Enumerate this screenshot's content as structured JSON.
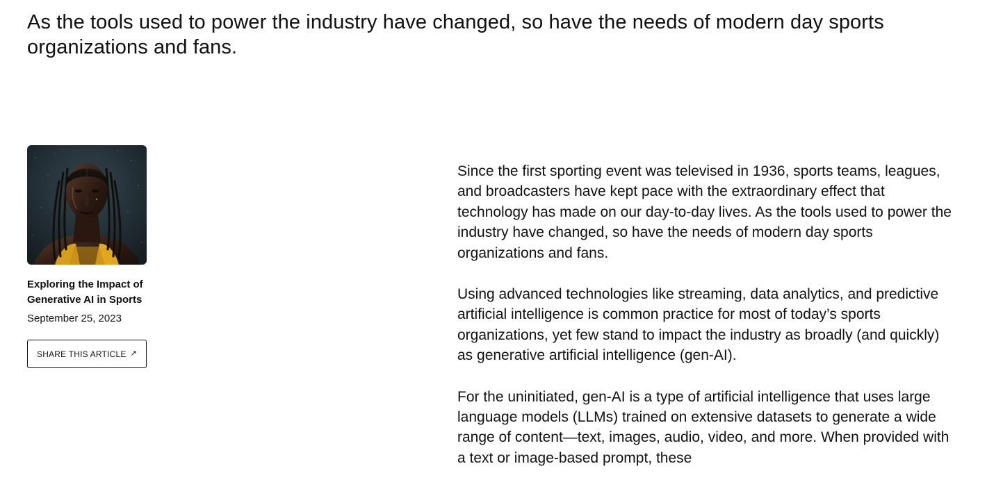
{
  "lede": "As the tools used to power the industry have changed, so have the needs of modern day sports organizations and fans.",
  "sidebar": {
    "image_alt": "Portrait of an athlete with braided hair in the rain",
    "title": "Exploring the Impact of Generative AI in Sports",
    "date": "September 25, 2023",
    "share_label": "SHARE THIS ARTICLE",
    "share_icon": "arrow-up-right-icon"
  },
  "article": {
    "paragraphs": [
      "Since the first sporting event was televised in 1936, sports teams, leagues, and broadcasters have kept pace with the extraordinary effect that technology has made on our day-to-day lives. As the tools used to power the industry have changed, so have the needs of modern day sports organizations and fans.",
      "Using advanced technologies like streaming, data analytics, and predictive artificial intelligence is common practice for most of today’s sports organizations, yet few stand to impact the industry as broadly (and quickly) as generative artificial intelligence (gen-AI).",
      "For the uninitiated, gen-AI is a type of artificial intelligence that uses large language models (LLMs) trained on extensive datasets to generate a wide range of content—text, images, audio, video, and more. When provided with a text or image-based prompt, these"
    ]
  },
  "colors": {
    "text": "#111111",
    "background": "#ffffff",
    "image_bg": "#1e2a30",
    "image_accent": "#e0a722"
  }
}
